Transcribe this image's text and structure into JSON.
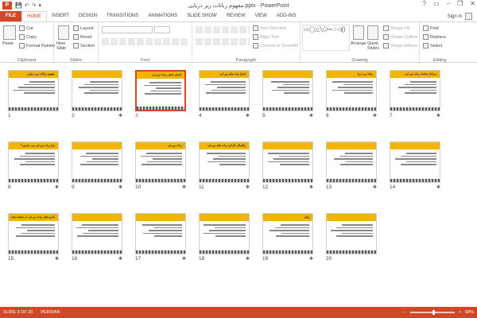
{
  "window": {
    "title": "مفهوم رباتات زیر دریایی.pptx - PowerPoint",
    "logo": "P",
    "minimize": "–",
    "restore": "❐",
    "close": "✕",
    "help": "?",
    "ribbon_options": "▭"
  },
  "qat": {
    "save": "💾",
    "undo": "↶",
    "redo": "↷",
    "customize": "▾"
  },
  "tabs": [
    {
      "label": "FILE"
    },
    {
      "label": "HOME"
    },
    {
      "label": "INSERT"
    },
    {
      "label": "DESIGN"
    },
    {
      "label": "TRANSITIONS"
    },
    {
      "label": "ANIMATIONS"
    },
    {
      "label": "SLIDE SHOW"
    },
    {
      "label": "REVIEW"
    },
    {
      "label": "VIEW"
    },
    {
      "label": "ADD-INS"
    }
  ],
  "signin": "Sign in",
  "ribbon": {
    "clipboard": {
      "paste": "Paste",
      "cut": "Cut",
      "copy": "Copy",
      "format_painter": "Format Painter",
      "label": "Clipboard"
    },
    "slides": {
      "new_slide": "New Slide",
      "layout": "Layout",
      "reset": "Reset",
      "section": "Section",
      "label": "Slides"
    },
    "font": {
      "label": "Font"
    },
    "paragraph": {
      "text_direction": "Text Direction",
      "align_text": "Align Text",
      "smartart": "Convert to SmartArt",
      "label": "Paragraph"
    },
    "drawing": {
      "shapes_glyphs": "▭◯△╲⬠⇨☆◁{}",
      "arrange": "Arrange",
      "quick_styles": "Quick Styles",
      "shape_fill": "Shape Fill",
      "shape_outline": "Shape Outline",
      "shape_effects": "Shape Effects",
      "label": "Drawing"
    },
    "editing": {
      "find": "Find",
      "replace": "Replace",
      "select": "Select",
      "label": "Editing"
    }
  },
  "slides": [
    {
      "num": "1",
      "title": "مفهوم رباتات زیر دریایی",
      "star": ""
    },
    {
      "num": "2",
      "title": "",
      "star": "✱"
    },
    {
      "num": "3",
      "title": "اجزای اصلی ربات زیر آبی",
      "star": ""
    },
    {
      "num": "4",
      "title": "انواع ربات های زیر آبی",
      "star": "✱"
    },
    {
      "num": "5",
      "title": "",
      "star": "✱"
    },
    {
      "num": "6",
      "title": "ربات زیر دریا",
      "star": "✱"
    },
    {
      "num": "7",
      "title": "مراحل ساخت ربات زیر آبی",
      "star": "✱"
    },
    {
      "num": "8",
      "title": "چرا ربات زیر آبی می سازیم ؟",
      "star": "✱"
    },
    {
      "num": "9",
      "title": "",
      "star": "✱"
    },
    {
      "num": "10",
      "title": "ربات زیر آبی",
      "star": "✱"
    },
    {
      "num": "11",
      "title": "چگونگی کارکرد ربات های زیر آبی",
      "star": "✱"
    },
    {
      "num": "12",
      "title": "",
      "star": "✱"
    },
    {
      "num": "13",
      "title": "",
      "star": "✱"
    },
    {
      "num": "14",
      "title": "",
      "star": "✱"
    },
    {
      "num": "15",
      "title": "کاربردهای ربات زیر آبی در صنعت نفت",
      "star": "✱"
    },
    {
      "num": "16",
      "title": "",
      "star": "✱"
    },
    {
      "num": "17",
      "title": "",
      "star": "✱"
    },
    {
      "num": "18",
      "title": "",
      "star": "✱"
    },
    {
      "num": "19",
      "title": "پایان",
      "star": "✱"
    },
    {
      "num": "20",
      "title": "",
      "star": ""
    }
  ],
  "selected_slide": "3",
  "status": {
    "slide_info": "SLIDE 3 OF 20",
    "language": "PERSIAN",
    "zoom": "68%",
    "zoom_minus": "–",
    "zoom_plus": "+"
  },
  "colors": {
    "accent": "#d24726",
    "slide_bar": "#f1b500"
  }
}
